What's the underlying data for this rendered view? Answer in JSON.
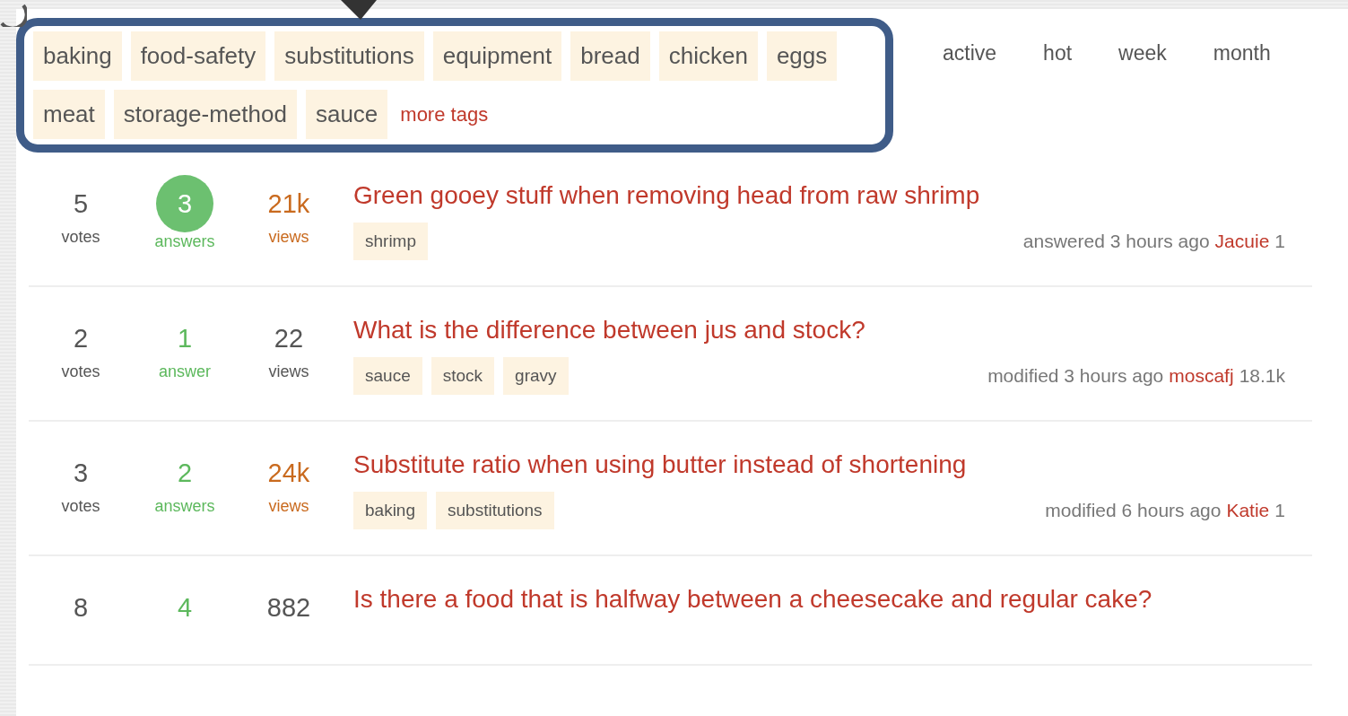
{
  "tag_cloud": {
    "tags": [
      "baking",
      "food-safety",
      "substitutions",
      "equipment",
      "bread",
      "chicken",
      "eggs",
      "meat",
      "storage-method",
      "sauce"
    ],
    "more_link": "more tags"
  },
  "sort_tabs": [
    "active",
    "hot",
    "week",
    "month"
  ],
  "questions": [
    {
      "votes": "5",
      "votes_label": "votes",
      "answers": "3",
      "answers_label": "answers",
      "accepted": true,
      "views": "21k",
      "views_label": "views",
      "hot": true,
      "title": "Green gooey stuff when removing head from raw shrimp",
      "tags": [
        "shrimp"
      ],
      "action": "answered 3 hours ago",
      "user": "Jacuie",
      "reputation": "1"
    },
    {
      "votes": "2",
      "votes_label": "votes",
      "answers": "1",
      "answers_label": "answer",
      "accepted": false,
      "views": "22",
      "views_label": "views",
      "hot": false,
      "title": "What is the difference between jus and stock?",
      "tags": [
        "sauce",
        "stock",
        "gravy"
      ],
      "action": "modified 3 hours ago",
      "user": "moscafj",
      "reputation": "18.1k"
    },
    {
      "votes": "3",
      "votes_label": "votes",
      "answers": "2",
      "answers_label": "answers",
      "accepted": false,
      "views": "24k",
      "views_label": "views",
      "hot": true,
      "title": "Substitute ratio when using butter instead of shortening",
      "tags": [
        "baking",
        "substitutions"
      ],
      "action": "modified 6 hours ago",
      "user": "Katie",
      "reputation": "1"
    },
    {
      "votes": "8",
      "answers": "4",
      "accepted": false,
      "views": "882",
      "hot": false,
      "title": "Is there a food that is halfway between a cheesecake and regular cake?"
    }
  ]
}
